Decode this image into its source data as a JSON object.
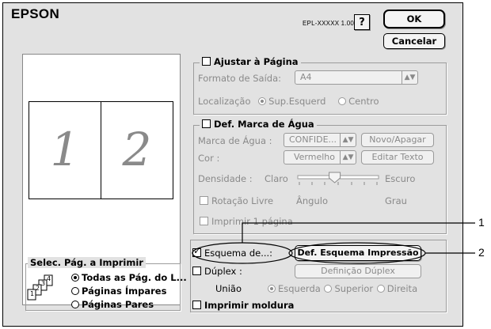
{
  "header": {
    "logo": "EPSON",
    "model": "EPL-XXXXX  1.00",
    "help_label": "?",
    "ok_label": "OK",
    "cancel_label": "Cancelar"
  },
  "preview": {
    "page1": "1",
    "page2": "2"
  },
  "fit_page": {
    "title": "Ajustar à Página",
    "output_format_label": "Formato de Saída:",
    "output_format_value": "A4",
    "location_label": "Localização",
    "opt_left_top": "Sup.Esquerd",
    "opt_center": "Centro"
  },
  "watermark": {
    "title": "Def. Marca de Água",
    "mark_label": "Marca de Água :",
    "mark_value": "CONFIDE...",
    "new_delete_label": "Novo/Apagar",
    "color_label": "Cor :",
    "color_value": "Vermelho",
    "edit_text_label": "Editar Texto",
    "density_label": "Densidade :",
    "density_light": "Claro",
    "density_dark": "Escuro",
    "density_level": 0.45,
    "free_rotation": "Rotação Livre",
    "angle_label": "Ângulo",
    "degrees_label": "Grau",
    "print_first_page": "Imprimir 1 página"
  },
  "layout": {
    "layout_label": "Esquema de...:",
    "layout_checked": true,
    "layout_settings_button": "Def. Esquema Impressão",
    "duplex_label": "Dúplex :",
    "duplex_settings_button": "Definição Dúplex",
    "binding_label": "União",
    "opt_left": "Esquerda",
    "opt_top": "Superior",
    "opt_right": "Direita",
    "print_frame_label": "Imprimir moldura"
  },
  "page_select": {
    "title": "Selec. Pág. a Imprimir",
    "opt_all": "Todas as Pág. do L...",
    "opt_odd": "Páginas Ímpares",
    "opt_even": "Páginas Pares",
    "icon_pages": [
      "1",
      "2",
      "3",
      "4"
    ]
  },
  "callouts": {
    "one": "1",
    "two": "2"
  }
}
